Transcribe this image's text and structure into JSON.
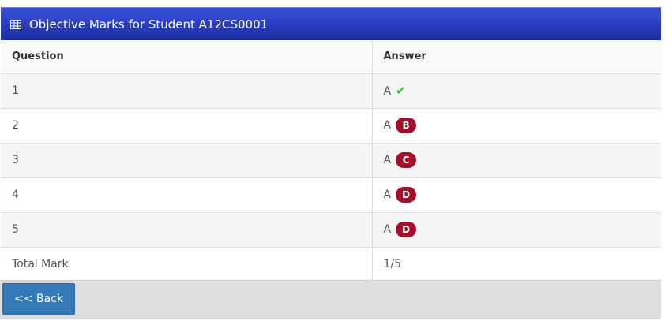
{
  "panel": {
    "title": "Objective Marks for Student A12CS0001",
    "title_icon": "table-grid-icon",
    "header_color": "#2b3fc4"
  },
  "table": {
    "headers": [
      "Question",
      "Answer"
    ],
    "rows": [
      {
        "question": "1",
        "answer": "A",
        "result": "correct",
        "mark": "✔"
      },
      {
        "question": "2",
        "answer": "A",
        "result": "wrong",
        "mark": "B"
      },
      {
        "question": "3",
        "answer": "A",
        "result": "wrong",
        "mark": "C"
      },
      {
        "question": "4",
        "answer": "A",
        "result": "wrong",
        "mark": "D"
      },
      {
        "question": "5",
        "answer": "A",
        "result": "wrong",
        "mark": "D"
      }
    ],
    "total_label": "Total Mark",
    "total_value": "1/5",
    "correct_color": "#22cc22",
    "wrong_badge_color": "#a50e2a"
  },
  "footer": {
    "back_label": "<< Back",
    "back_color": "#3379b8"
  }
}
